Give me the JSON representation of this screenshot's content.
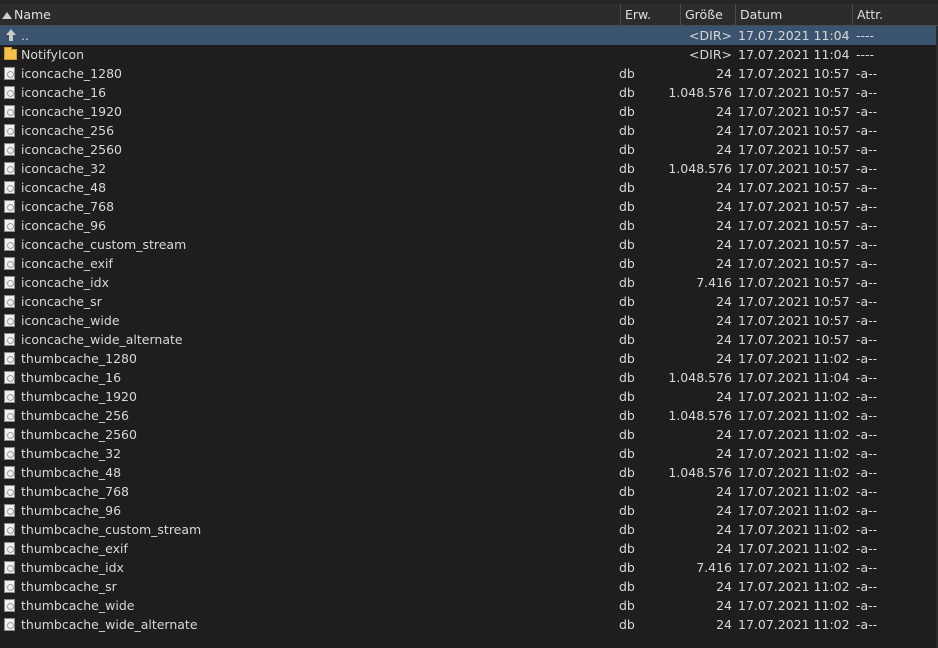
{
  "columns": {
    "name": "Name",
    "ext": "Erw.",
    "size": "Größe",
    "date": "Datum",
    "attr": "Attr."
  },
  "rows": [
    {
      "icon": "up-icon",
      "name": "..",
      "ext": "",
      "size": "<DIR>",
      "date": "17.07.2021 11:04",
      "attr": "----",
      "selected": true
    },
    {
      "icon": "folder-icon",
      "name": "NotifyIcon",
      "ext": "",
      "size": "<DIR>",
      "date": "17.07.2021 11:04",
      "attr": "----"
    },
    {
      "icon": "file-icon",
      "name": "iconcache_1280",
      "ext": "db",
      "size": "24",
      "date": "17.07.2021 10:57",
      "attr": "-a--"
    },
    {
      "icon": "file-icon",
      "name": "iconcache_16",
      "ext": "db",
      "size": "1.048.576",
      "date": "17.07.2021 10:57",
      "attr": "-a--"
    },
    {
      "icon": "file-icon",
      "name": "iconcache_1920",
      "ext": "db",
      "size": "24",
      "date": "17.07.2021 10:57",
      "attr": "-a--"
    },
    {
      "icon": "file-icon",
      "name": "iconcache_256",
      "ext": "db",
      "size": "24",
      "date": "17.07.2021 10:57",
      "attr": "-a--"
    },
    {
      "icon": "file-icon",
      "name": "iconcache_2560",
      "ext": "db",
      "size": "24",
      "date": "17.07.2021 10:57",
      "attr": "-a--"
    },
    {
      "icon": "file-icon",
      "name": "iconcache_32",
      "ext": "db",
      "size": "1.048.576",
      "date": "17.07.2021 10:57",
      "attr": "-a--"
    },
    {
      "icon": "file-icon",
      "name": "iconcache_48",
      "ext": "db",
      "size": "24",
      "date": "17.07.2021 10:57",
      "attr": "-a--"
    },
    {
      "icon": "file-icon",
      "name": "iconcache_768",
      "ext": "db",
      "size": "24",
      "date": "17.07.2021 10:57",
      "attr": "-a--"
    },
    {
      "icon": "file-icon",
      "name": "iconcache_96",
      "ext": "db",
      "size": "24",
      "date": "17.07.2021 10:57",
      "attr": "-a--"
    },
    {
      "icon": "file-icon",
      "name": "iconcache_custom_stream",
      "ext": "db",
      "size": "24",
      "date": "17.07.2021 10:57",
      "attr": "-a--"
    },
    {
      "icon": "file-icon",
      "name": "iconcache_exif",
      "ext": "db",
      "size": "24",
      "date": "17.07.2021 10:57",
      "attr": "-a--"
    },
    {
      "icon": "file-icon",
      "name": "iconcache_idx",
      "ext": "db",
      "size": "7.416",
      "date": "17.07.2021 10:57",
      "attr": "-a--"
    },
    {
      "icon": "file-icon",
      "name": "iconcache_sr",
      "ext": "db",
      "size": "24",
      "date": "17.07.2021 10:57",
      "attr": "-a--"
    },
    {
      "icon": "file-icon",
      "name": "iconcache_wide",
      "ext": "db",
      "size": "24",
      "date": "17.07.2021 10:57",
      "attr": "-a--"
    },
    {
      "icon": "file-icon",
      "name": "iconcache_wide_alternate",
      "ext": "db",
      "size": "24",
      "date": "17.07.2021 10:57",
      "attr": "-a--"
    },
    {
      "icon": "file-icon",
      "name": "thumbcache_1280",
      "ext": "db",
      "size": "24",
      "date": "17.07.2021 11:02",
      "attr": "-a--"
    },
    {
      "icon": "file-icon",
      "name": "thumbcache_16",
      "ext": "db",
      "size": "1.048.576",
      "date": "17.07.2021 11:04",
      "attr": "-a--"
    },
    {
      "icon": "file-icon",
      "name": "thumbcache_1920",
      "ext": "db",
      "size": "24",
      "date": "17.07.2021 11:02",
      "attr": "-a--"
    },
    {
      "icon": "file-icon",
      "name": "thumbcache_256",
      "ext": "db",
      "size": "1.048.576",
      "date": "17.07.2021 11:02",
      "attr": "-a--"
    },
    {
      "icon": "file-icon",
      "name": "thumbcache_2560",
      "ext": "db",
      "size": "24",
      "date": "17.07.2021 11:02",
      "attr": "-a--"
    },
    {
      "icon": "file-icon",
      "name": "thumbcache_32",
      "ext": "db",
      "size": "24",
      "date": "17.07.2021 11:02",
      "attr": "-a--"
    },
    {
      "icon": "file-icon",
      "name": "thumbcache_48",
      "ext": "db",
      "size": "1.048.576",
      "date": "17.07.2021 11:02",
      "attr": "-a--"
    },
    {
      "icon": "file-icon",
      "name": "thumbcache_768",
      "ext": "db",
      "size": "24",
      "date": "17.07.2021 11:02",
      "attr": "-a--"
    },
    {
      "icon": "file-icon",
      "name": "thumbcache_96",
      "ext": "db",
      "size": "24",
      "date": "17.07.2021 11:02",
      "attr": "-a--"
    },
    {
      "icon": "file-icon",
      "name": "thumbcache_custom_stream",
      "ext": "db",
      "size": "24",
      "date": "17.07.2021 11:02",
      "attr": "-a--"
    },
    {
      "icon": "file-icon",
      "name": "thumbcache_exif",
      "ext": "db",
      "size": "24",
      "date": "17.07.2021 11:02",
      "attr": "-a--"
    },
    {
      "icon": "file-icon",
      "name": "thumbcache_idx",
      "ext": "db",
      "size": "7.416",
      "date": "17.07.2021 11:02",
      "attr": "-a--"
    },
    {
      "icon": "file-icon",
      "name": "thumbcache_sr",
      "ext": "db",
      "size": "24",
      "date": "17.07.2021 11:02",
      "attr": "-a--"
    },
    {
      "icon": "file-icon",
      "name": "thumbcache_wide",
      "ext": "db",
      "size": "24",
      "date": "17.07.2021 11:02",
      "attr": "-a--"
    },
    {
      "icon": "file-icon",
      "name": "thumbcache_wide_alternate",
      "ext": "db",
      "size": "24",
      "date": "17.07.2021 11:02",
      "attr": "-a--"
    }
  ]
}
